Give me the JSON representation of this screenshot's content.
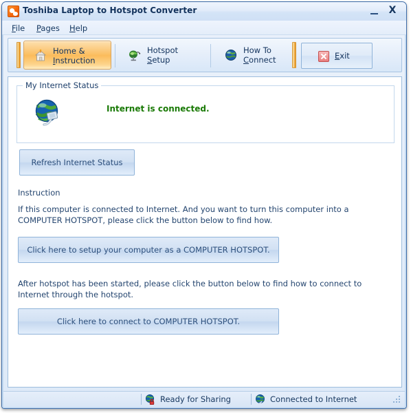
{
  "window": {
    "title": "Toshiba Laptop to Hotspot Converter",
    "app_icon": "toshiba-app-icon",
    "minimize_label": "_",
    "close_label": "X"
  },
  "menubar": {
    "items": [
      {
        "label": "File",
        "accel": "F",
        "name": "menu-file"
      },
      {
        "label": "Pages",
        "accel": "P",
        "name": "menu-pages"
      },
      {
        "label": "Help",
        "accel": "H",
        "name": "menu-help"
      }
    ]
  },
  "toolbar": {
    "tabs": [
      {
        "line1": "Home &",
        "line2": "Instruction",
        "accel": "I",
        "icon": "house-icon",
        "selected": true
      },
      {
        "line1": "Hotspot",
        "line2": "Setup",
        "accel": "S",
        "icon": "satellite-dish-icon",
        "selected": false
      },
      {
        "line1": "How To",
        "line2": "Connect",
        "accel": "C",
        "icon": "globe-icon",
        "selected": false
      }
    ],
    "exit": {
      "label": "Exit",
      "accel": "E",
      "icon": "close-x-icon"
    }
  },
  "main": {
    "groupbox": {
      "title": "My Internet Status",
      "icon": "globe-network-plug-icon",
      "status_text": "Internet is connected.",
      "status_color": "#1a7a06"
    },
    "refresh_button": "Refresh Internet Status",
    "instruction_label": "Instruction",
    "paragraph_1": "If this computer is connected to Internet. And you want to turn this computer into a COMPUTER HOTSPOT, please click the button below to find how.",
    "setup_button": "Click here to setup your computer as a COMPUTER HOTSPOT.",
    "paragraph_2": "After hotspot has been started, please click the button below to find how to connect to Internet through the hotspot.",
    "connect_button": "Click here to connect to COMPUTER HOTSPOT."
  },
  "statusbar": {
    "sharing": {
      "label": "Ready for Sharing",
      "icon": "globe-lock-icon"
    },
    "internet": {
      "label": "Connected to Internet",
      "icon": "globe-icon"
    }
  }
}
